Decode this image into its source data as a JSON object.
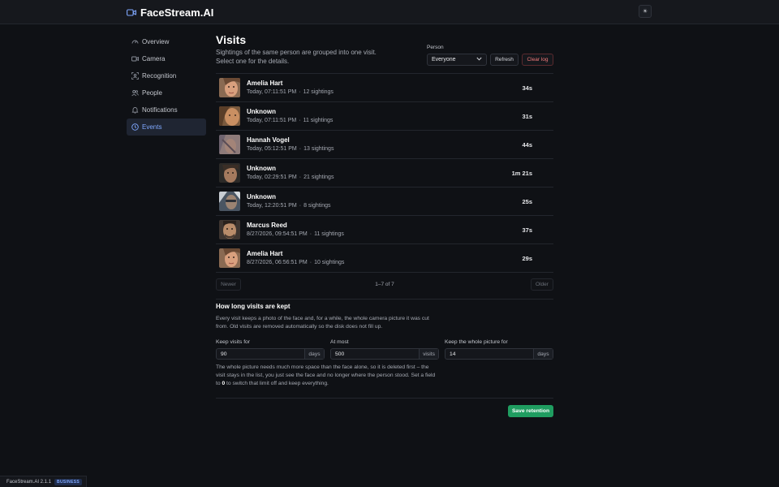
{
  "app": {
    "name": "FaceStream.AI",
    "version_label": "FaceStream.AI 2.1.1",
    "edition": "BUSINESS",
    "theme_toggle": "☀"
  },
  "sidebar": {
    "items": [
      {
        "label": "Overview",
        "icon": "dashboard-icon",
        "active": false
      },
      {
        "label": "Camera",
        "icon": "camera-icon",
        "active": false
      },
      {
        "label": "Recognition",
        "icon": "recognition-icon",
        "active": false
      },
      {
        "label": "People",
        "icon": "people-icon",
        "active": false
      },
      {
        "label": "Notifications",
        "icon": "bell-icon",
        "active": false
      },
      {
        "label": "Events",
        "icon": "clock-icon",
        "active": true
      }
    ]
  },
  "header": {
    "title": "Visits",
    "subtitle": "Sightings of the same person are grouped into one visit. Select one for the details.",
    "person_label": "Person",
    "person_value": "Everyone",
    "refresh_label": "Refresh",
    "clear_label": "Clear log"
  },
  "visits": [
    {
      "name": "Amelia Hart",
      "time": "Today, 07:11:51 PM",
      "sightings": "12 sightings",
      "duration": "34s"
    },
    {
      "name": "Unknown",
      "time": "Today, 07:11:51 PM",
      "sightings": "11 sightings",
      "duration": "31s"
    },
    {
      "name": "Hannah Vogel",
      "time": "Today, 05:12:51 PM",
      "sightings": "13 sightings",
      "duration": "44s"
    },
    {
      "name": "Unknown",
      "time": "Today, 02:29:51 PM",
      "sightings": "21 sightings",
      "duration": "1m 21s"
    },
    {
      "name": "Unknown",
      "time": "Today, 12:20:51 PM",
      "sightings": "8 sightings",
      "duration": "25s"
    },
    {
      "name": "Marcus Reed",
      "time": "8/27/2026, 09:54:51 PM",
      "sightings": "11 sightings",
      "duration": "37s"
    },
    {
      "name": "Amelia Hart",
      "time": "8/27/2026, 06:56:51 PM",
      "sightings": "10 sightings",
      "duration": "29s"
    }
  ],
  "pager": {
    "newer": "Newer",
    "count": "1–7 of 7",
    "older": "Older"
  },
  "retention": {
    "title": "How long visits are kept",
    "description": "Every visit keeps a photo of the face and, for a while, the whole camera picture it was cut from. Old visits are removed automatically so the disk does not fill up.",
    "fields": [
      {
        "label": "Keep visits for",
        "value": "90",
        "unit": "days"
      },
      {
        "label": "At most",
        "value": "500",
        "unit": "visits"
      },
      {
        "label": "Keep the whole picture for",
        "value": "14",
        "unit": "days"
      }
    ],
    "note_before": "The whole picture needs much more space than the face alone, so it is deleted first – the visit stays in the list, you just see the face and no longer where the person stood. Set a field to ",
    "note_zero": "0",
    "note_after": " to switch that limit off and keep everything.",
    "save_label": "Save retention"
  },
  "colors": {
    "accent": "#7fa8ff",
    "danger": "#f27a7a",
    "success": "#1f9d60",
    "background": "#0f1115"
  }
}
